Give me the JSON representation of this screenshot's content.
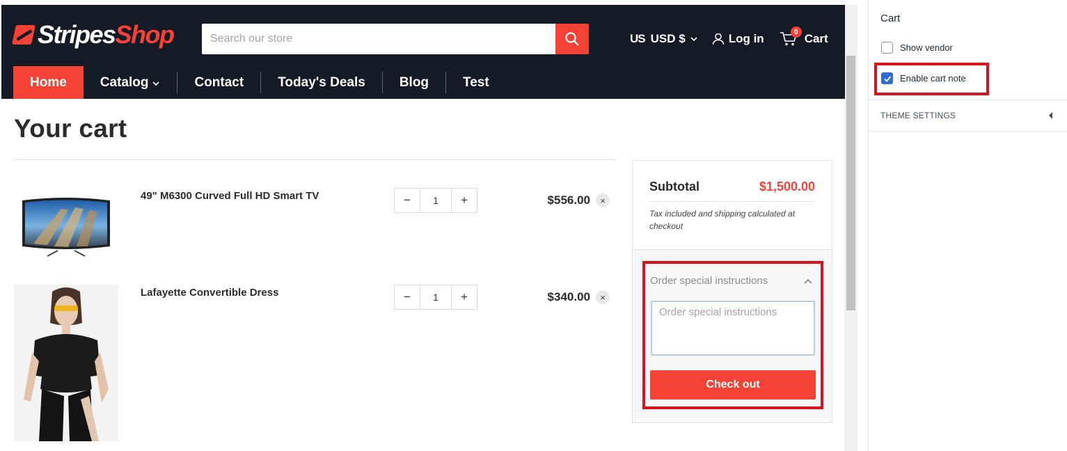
{
  "store": {
    "logo_part1": "Stripes",
    "logo_part2": "Shop",
    "search_placeholder": "Search our store",
    "currency_flag": "US",
    "currency": "USD $",
    "login": "Log in",
    "cart_label": "Cart",
    "cart_count": "0"
  },
  "nav": {
    "items": [
      {
        "label": "Home",
        "active": true
      },
      {
        "label": "Catalog",
        "dropdown": true
      },
      {
        "label": "Contact"
      },
      {
        "label": "Today's Deals"
      },
      {
        "label": "Blog"
      },
      {
        "label": "Test"
      }
    ]
  },
  "cart": {
    "title": "Your cart",
    "items": [
      {
        "title": "49\" M6300 Curved Full HD Smart TV",
        "qty": "1",
        "price": "$556.00",
        "image": "tv-image"
      },
      {
        "title": "Lafayette Convertible Dress",
        "qty": "1",
        "price": "$340.00",
        "image": "dress-image"
      }
    ],
    "minus": "−",
    "plus": "+",
    "remove": "×"
  },
  "summary": {
    "subtotal_label": "Subtotal",
    "subtotal_value": "$1,500.00",
    "tax_note": "Tax included and shipping calculated at checkout",
    "note_heading": "Order special instructions",
    "note_placeholder": "Order special instructions",
    "checkout_label": "Check out"
  },
  "panel": {
    "title": "Cart",
    "options": [
      {
        "label": "Show vendor",
        "checked": false
      },
      {
        "label": "Enable cart note",
        "checked": true
      }
    ],
    "theme_settings": "THEME SETTINGS"
  },
  "colors": {
    "header_bg": "#141b26",
    "accent": "#f44336",
    "highlight": "#d9121b",
    "checkbox_checked": "#2c6ecb"
  }
}
